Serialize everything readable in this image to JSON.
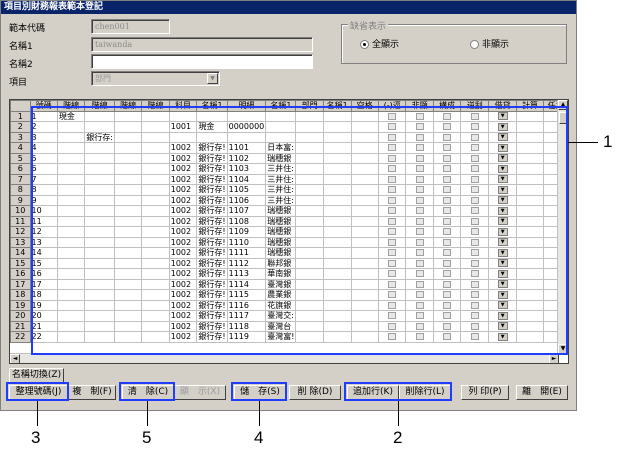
{
  "window": {
    "title": "項目別財務報表範本登記"
  },
  "form": {
    "code_label": "範本代碼",
    "code_value": "chen001",
    "name1_label": "名稱1",
    "name1_value": "taiwanda",
    "name2_label": "名稱2",
    "name2_value": "",
    "item_label": "項目",
    "item_value": "部門"
  },
  "display_group": {
    "title": "缺省表示",
    "show_all": "全顯示",
    "hide": "非顯示"
  },
  "grid": {
    "headers": [
      "號碼",
      "階線",
      "階線",
      "階線",
      "階線",
      "科目",
      "名稱1",
      "明細",
      "名稱1",
      "部門",
      "名稱1",
      "空格",
      "(-)逼",
      "非顯",
      "構成",
      "逆刮",
      "借貸",
      "計算",
      "任意"
    ],
    "rows": [
      [
        "1",
        "1",
        "現金",
        "",
        "",
        "",
        "",
        "",
        "",
        "",
        "",
        "",
        "",
        "",
        "",
        "",
        "",
        "",
        "",
        ""
      ],
      [
        "2",
        "2",
        "",
        "",
        "",
        "",
        "1001",
        "現金",
        "0000000",
        "",
        "",
        "",
        "",
        "",
        "",
        "",
        "",
        "",
        "",
        ""
      ],
      [
        "3",
        "3",
        "",
        "銀行存:",
        "",
        "",
        "",
        "",
        "",
        "",
        "",
        "",
        "",
        "",
        "",
        "",
        "",
        "",
        "",
        ""
      ],
      [
        "4",
        "4",
        "",
        "",
        "",
        "",
        "1002",
        "銀行存!",
        "1101",
        "日本富:",
        "",
        "",
        "",
        "",
        "",
        "",
        "",
        "",
        "",
        ""
      ],
      [
        "5",
        "5",
        "",
        "",
        "",
        "",
        "1002",
        "銀行存!",
        "1102",
        "瑞穗銀",
        "",
        "",
        "",
        "",
        "",
        "",
        "",
        "",
        "",
        ""
      ],
      [
        "6",
        "6",
        "",
        "",
        "",
        "",
        "1002",
        "銀行存!",
        "1103",
        "三井住:",
        "",
        "",
        "",
        "",
        "",
        "",
        "",
        "",
        "",
        ""
      ],
      [
        "7",
        "7",
        "",
        "",
        "",
        "",
        "1002",
        "銀行存!",
        "1104",
        "三井住:",
        "",
        "",
        "",
        "",
        "",
        "",
        "",
        "",
        "",
        ""
      ],
      [
        "8",
        "8",
        "",
        "",
        "",
        "",
        "1002",
        "銀行存!",
        "1105",
        "三井住:",
        "",
        "",
        "",
        "",
        "",
        "",
        "",
        "",
        "",
        ""
      ],
      [
        "9",
        "9",
        "",
        "",
        "",
        "",
        "1002",
        "銀行存!",
        "1106",
        "三井住:",
        "",
        "",
        "",
        "",
        "",
        "",
        "",
        "",
        "",
        ""
      ],
      [
        "10",
        "10",
        "",
        "",
        "",
        "",
        "1002",
        "銀行存!",
        "1107",
        "瑞穗銀",
        "",
        "",
        "",
        "",
        "",
        "",
        "",
        "",
        "",
        ""
      ],
      [
        "11",
        "11",
        "",
        "",
        "",
        "",
        "1002",
        "銀行存!",
        "1108",
        "瑞穗銀",
        "",
        "",
        "",
        "",
        "",
        "",
        "",
        "",
        "",
        ""
      ],
      [
        "12",
        "12",
        "",
        "",
        "",
        "",
        "1002",
        "銀行存!",
        "1109",
        "瑞穗銀",
        "",
        "",
        "",
        "",
        "",
        "",
        "",
        "",
        "",
        ""
      ],
      [
        "13",
        "13",
        "",
        "",
        "",
        "",
        "1002",
        "銀行存!",
        "1110",
        "瑞穗銀",
        "",
        "",
        "",
        "",
        "",
        "",
        "",
        "",
        "",
        ""
      ],
      [
        "14",
        "14",
        "",
        "",
        "",
        "",
        "1002",
        "銀行存!",
        "1111",
        "瑞穗銀",
        "",
        "",
        "",
        "",
        "",
        "",
        "",
        "",
        "",
        ""
      ],
      [
        "15",
        "15",
        "",
        "",
        "",
        "",
        "1002",
        "銀行存!",
        "1112",
        "聯邦銀",
        "",
        "",
        "",
        "",
        "",
        "",
        "",
        "",
        "",
        ""
      ],
      [
        "16",
        "16",
        "",
        "",
        "",
        "",
        "1002",
        "銀行存!",
        "1113",
        "華南銀",
        "",
        "",
        "",
        "",
        "",
        "",
        "",
        "",
        "",
        ""
      ],
      [
        "17",
        "17",
        "",
        "",
        "",
        "",
        "1002",
        "銀行存!",
        "1114",
        "臺灣銀",
        "",
        "",
        "",
        "",
        "",
        "",
        "",
        "",
        "",
        ""
      ],
      [
        "18",
        "18",
        "",
        "",
        "",
        "",
        "1002",
        "銀行存!",
        "1115",
        "農業銀",
        "",
        "",
        "",
        "",
        "",
        "",
        "",
        "",
        "",
        ""
      ],
      [
        "19",
        "19",
        "",
        "",
        "",
        "",
        "1002",
        "銀行存!",
        "1116",
        "花旗銀",
        "",
        "",
        "",
        "",
        "",
        "",
        "",
        "",
        "",
        ""
      ],
      [
        "20",
        "20",
        "",
        "",
        "",
        "",
        "1002",
        "銀行存!",
        "1117",
        "臺灣交:",
        "",
        "",
        "",
        "",
        "",
        "",
        "",
        "",
        "",
        ""
      ],
      [
        "21",
        "21",
        "",
        "",
        "",
        "",
        "1002",
        "銀行存!",
        "1118",
        "臺灣台",
        "",
        "",
        "",
        "",
        "",
        "",
        "",
        "",
        "",
        ""
      ],
      [
        "22",
        "22",
        "",
        "",
        "",
        "",
        "1002",
        "銀行存!",
        "1119",
        "臺灣富!",
        "",
        "",
        "",
        "",
        "",
        "",
        "",
        "",
        "",
        ""
      ]
    ]
  },
  "buttons": {
    "switch_name": "名稱切換(Z)",
    "renumber": "整理號碼(J)",
    "copy": "複　制(F)",
    "clear": "清　除(C)",
    "display": "顯　示(X)",
    "save": "儲　存(S)",
    "delete": "削 除(D)",
    "add_row": "追加行(K)",
    "delete_row": "削除行(L)",
    "print": "列 印(P)",
    "close": "離　開(E)"
  },
  "callouts": [
    "1",
    "2",
    "3",
    "4",
    "5"
  ]
}
